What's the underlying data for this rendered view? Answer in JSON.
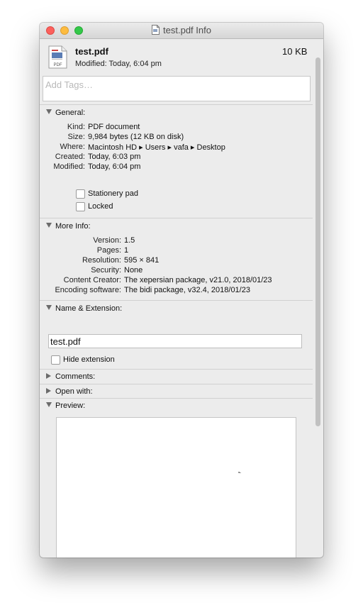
{
  "window": {
    "title": "test.pdf Info",
    "title_icon": "document-icon"
  },
  "header": {
    "file_name": "test.pdf",
    "file_size": "10 KB",
    "modified_label": "Modified:",
    "modified_value": "Today, 6:04 pm",
    "file_icon": "pdf-file-icon",
    "file_icon_badge": "PDF"
  },
  "tags": {
    "placeholder": "Add Tags…"
  },
  "general": {
    "title": "General:",
    "rows": [
      {
        "label": "Kind:",
        "value": "PDF document"
      },
      {
        "label": "Size:",
        "value": "9,984 bytes (12 KB on disk)"
      },
      {
        "label": "Where:",
        "value": "Macintosh HD ▸ Users ▸ vafa ▸ Desktop"
      },
      {
        "label": "Created:",
        "value": "Today, 6:03 pm"
      },
      {
        "label": "Modified:",
        "value": "Today, 6:04 pm"
      }
    ],
    "stationery_label": "Stationery pad",
    "locked_label": "Locked"
  },
  "more_info": {
    "title": "More Info:",
    "rows": [
      {
        "label": "Version:",
        "value": "1.5"
      },
      {
        "label": "Pages:",
        "value": "1"
      },
      {
        "label": "Resolution:",
        "value": "595 × 841"
      },
      {
        "label": "Security:",
        "value": "None"
      },
      {
        "label": "Content Creator:",
        "value": "The xepersian package, v21.0, 2018/01/23"
      },
      {
        "label": "Encoding software:",
        "value": "The bidi package, v32.4, 2018/01/23"
      }
    ]
  },
  "name_extension": {
    "title": "Name & Extension:",
    "value": "test.pdf",
    "hide_extension_label": "Hide extension"
  },
  "comments": {
    "title": "Comments:"
  },
  "open_with": {
    "title": "Open with:"
  },
  "preview": {
    "title": "Preview:",
    "mark": "؎"
  },
  "colors": {
    "close": "#fc605c",
    "minimize": "#fdbc40",
    "maximize": "#34c84a",
    "window_bg": "#ececec"
  }
}
